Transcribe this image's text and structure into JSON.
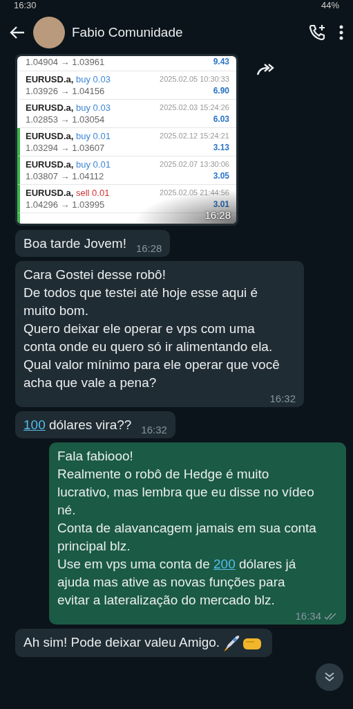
{
  "status_bar": {
    "time": "16:30",
    "battery": "44%"
  },
  "header": {
    "title": "Fabio Comunidade"
  },
  "messages": [
    {
      "kind": "image",
      "time": "16:28",
      "trades": [
        {
          "prices": "1.04904 → 1.03961",
          "profit": "9.43",
          "highlighted": false
        },
        {
          "symbol": "EURUSD.a,",
          "side": "buy 0.03",
          "color": "#3b86d6",
          "date": "2025.02.05 10:30:33",
          "prices": "1.03926 → 1.04156",
          "profit": "6.90",
          "highlighted": false
        },
        {
          "symbol": "EURUSD.a,",
          "side": "buy 0.03",
          "color": "#3b86d6",
          "date": "2025.02.03 15:24:26",
          "prices": "1.02853 → 1.03054",
          "profit": "6.03",
          "highlighted": false
        },
        {
          "symbol": "EURUSD.a,",
          "side": "buy 0.01",
          "color": "#3b86d6",
          "date": "2025.02.12 15:24:21",
          "prices": "1.03294 → 1.03607",
          "profit": "3.13",
          "highlighted": true
        },
        {
          "symbol": "EURUSD.a,",
          "side": "buy 0.01",
          "color": "#3b86d6",
          "date": "2025.02.07 13:30:06",
          "prices": "1.03807 → 1.04112",
          "profit": "3.05",
          "highlighted": true
        },
        {
          "symbol": "EURUSD.a,",
          "side": "sell 0.01",
          "color": "#d33333",
          "date": "2025.02.05 21:44:56",
          "prices": "1.04296 → 1.03995",
          "profit": "3.01",
          "highlighted": true
        },
        {
          "highlighted": true
        }
      ]
    },
    {
      "kind": "incoming",
      "text": "Boa tarde Jovem!",
      "time": "16:28"
    },
    {
      "kind": "incoming",
      "text": "Cara Gostei desse robô!\nDe todos que testei até hoje esse aqui é muito bom.\nQuero deixar ele operar e vps com uma conta onde eu quero só ir alimentando ela.\nQual valor mínimo para ele operar que você acha que vale a pena?",
      "time": "16:32"
    },
    {
      "kind": "incoming",
      "link": "100",
      "text_after": " dólares vira??",
      "time": "16:32"
    },
    {
      "kind": "outgoing",
      "text": "Fala fabiooo!\nRealmente o robô de Hedge é muito lucrativo, mas lembra que eu disse no vídeo né.\nConta de alavancagem jamais em sua conta principal blz.\nUse em vps uma conta de ",
      "link": "200",
      "text_after": " dólares já ajuda mas ative as novas funções para evitar a lateralização do mercado blz.",
      "time": "16:34",
      "read": true
    },
    {
      "kind": "incoming",
      "text": "Ah sim! Pode deixar valeu Amigo.",
      "emoji": true
    }
  ]
}
